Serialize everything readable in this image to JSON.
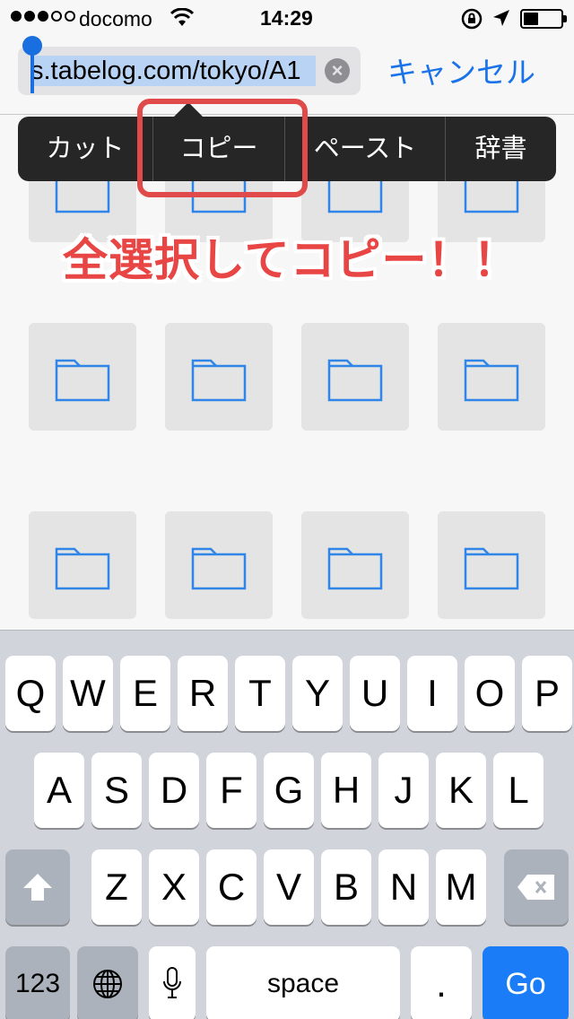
{
  "status_bar": {
    "carrier": "docomo",
    "time": "14:29",
    "signal_bars_filled": 3,
    "signal_bars_total": 5
  },
  "nav_bar": {
    "url_text": "s.tabelog.com/tokyo/A1",
    "cancel_label": "キャンセル"
  },
  "edit_menu": {
    "items": [
      "カット",
      "コピー",
      "ペースト",
      "辞書"
    ]
  },
  "annotation": "全選択してコピー！！",
  "keyboard": {
    "row1": [
      "Q",
      "W",
      "E",
      "R",
      "T",
      "Y",
      "U",
      "I",
      "O",
      "P"
    ],
    "row2": [
      "A",
      "S",
      "D",
      "F",
      "G",
      "H",
      "J",
      "K",
      "L"
    ],
    "row3": [
      "Z",
      "X",
      "C",
      "V",
      "B",
      "N",
      "M"
    ],
    "numbers_label": "123",
    "space_label": "space",
    "period_label": ".",
    "go_label": "Go"
  },
  "colors": {
    "accent": "#1a73e8",
    "annotation_red": "#e84545",
    "folder_blue": "#2f86e8"
  }
}
